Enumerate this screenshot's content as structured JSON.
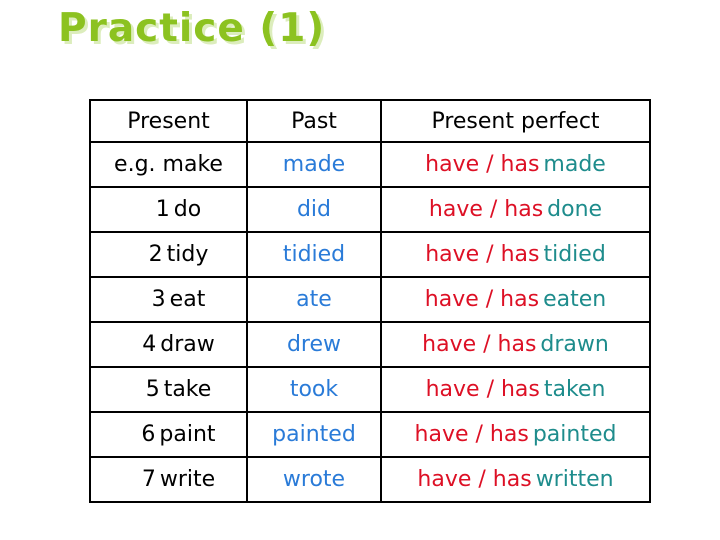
{
  "slide": {
    "title": "Practice (1)",
    "title_color": "#8CC220",
    "background_color": "#FFFFFF"
  },
  "colors": {
    "heading_text": "#000000",
    "present_text": "#000000",
    "past_text": "#2A7BD8",
    "auxiliary_text": "#DD1025",
    "participle_text": "#1E8C8C",
    "table_border": "#000000"
  },
  "table": {
    "headers": [
      "Present",
      "Past",
      "Present perfect"
    ],
    "rows": [
      {
        "num": "",
        "present": "e.g. make",
        "past": "made",
        "aux": "have / has",
        "participle": "made"
      },
      {
        "num": "1",
        "present": "do",
        "past": "did",
        "aux": "have / has",
        "participle": "done"
      },
      {
        "num": "2",
        "present": "tidy",
        "past": "tidied",
        "aux": "have / has",
        "participle": "tidied"
      },
      {
        "num": "3",
        "present": "eat",
        "past": "ate",
        "aux": "have / has",
        "participle": "eaten"
      },
      {
        "num": "4",
        "present": "draw",
        "past": "drew",
        "aux": "have / has",
        "participle": "drawn"
      },
      {
        "num": "5",
        "present": "take",
        "past": "took",
        "aux": "have / has",
        "participle": "taken"
      },
      {
        "num": "6",
        "present": "paint",
        "past": "painted",
        "aux": "have / has",
        "participle": "painted"
      },
      {
        "num": "7",
        "present": "write",
        "past": "wrote",
        "aux": "have / has",
        "participle": "written"
      }
    ]
  }
}
